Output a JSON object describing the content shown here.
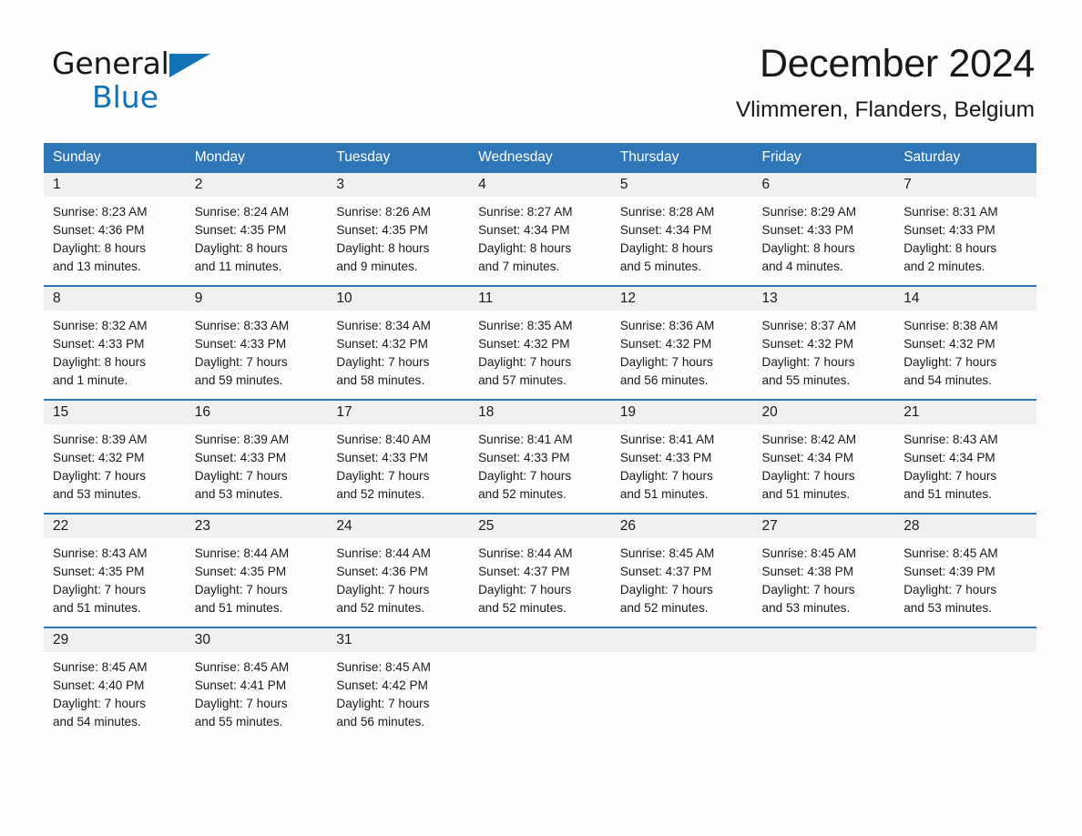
{
  "brand": {
    "word1": "General",
    "word2": "Blue",
    "triangle_color": "#1272b6",
    "text_color": "#17181a"
  },
  "header": {
    "title": "December 2024",
    "location": "Vlimmeren, Flanders, Belgium"
  },
  "theme": {
    "header_blue": "#2f76b8",
    "row_rule_blue": "#2f76b8",
    "daynum_band": "#f0f0f0",
    "page_background": "#fdfdfd",
    "text": "#1a1a1a"
  },
  "calendar": {
    "weekday_headers": [
      "Sunday",
      "Monday",
      "Tuesday",
      "Wednesday",
      "Thursday",
      "Friday",
      "Saturday"
    ],
    "labels": {
      "sunrise": "Sunrise:",
      "sunset": "Sunset:",
      "daylight": "Daylight:"
    },
    "weeks": [
      [
        {
          "day": "1",
          "sunrise": "Sunrise: 8:23 AM",
          "sunset": "Sunset: 4:36 PM",
          "daylight_line1": "Daylight: 8 hours",
          "daylight_line2": "and 13 minutes."
        },
        {
          "day": "2",
          "sunrise": "Sunrise: 8:24 AM",
          "sunset": "Sunset: 4:35 PM",
          "daylight_line1": "Daylight: 8 hours",
          "daylight_line2": "and 11 minutes."
        },
        {
          "day": "3",
          "sunrise": "Sunrise: 8:26 AM",
          "sunset": "Sunset: 4:35 PM",
          "daylight_line1": "Daylight: 8 hours",
          "daylight_line2": "and 9 minutes."
        },
        {
          "day": "4",
          "sunrise": "Sunrise: 8:27 AM",
          "sunset": "Sunset: 4:34 PM",
          "daylight_line1": "Daylight: 8 hours",
          "daylight_line2": "and 7 minutes."
        },
        {
          "day": "5",
          "sunrise": "Sunrise: 8:28 AM",
          "sunset": "Sunset: 4:34 PM",
          "daylight_line1": "Daylight: 8 hours",
          "daylight_line2": "and 5 minutes."
        },
        {
          "day": "6",
          "sunrise": "Sunrise: 8:29 AM",
          "sunset": "Sunset: 4:33 PM",
          "daylight_line1": "Daylight: 8 hours",
          "daylight_line2": "and 4 minutes."
        },
        {
          "day": "7",
          "sunrise": "Sunrise: 8:31 AM",
          "sunset": "Sunset: 4:33 PM",
          "daylight_line1": "Daylight: 8 hours",
          "daylight_line2": "and 2 minutes."
        }
      ],
      [
        {
          "day": "8",
          "sunrise": "Sunrise: 8:32 AM",
          "sunset": "Sunset: 4:33 PM",
          "daylight_line1": "Daylight: 8 hours",
          "daylight_line2": "and 1 minute."
        },
        {
          "day": "9",
          "sunrise": "Sunrise: 8:33 AM",
          "sunset": "Sunset: 4:33 PM",
          "daylight_line1": "Daylight: 7 hours",
          "daylight_line2": "and 59 minutes."
        },
        {
          "day": "10",
          "sunrise": "Sunrise: 8:34 AM",
          "sunset": "Sunset: 4:32 PM",
          "daylight_line1": "Daylight: 7 hours",
          "daylight_line2": "and 58 minutes."
        },
        {
          "day": "11",
          "sunrise": "Sunrise: 8:35 AM",
          "sunset": "Sunset: 4:32 PM",
          "daylight_line1": "Daylight: 7 hours",
          "daylight_line2": "and 57 minutes."
        },
        {
          "day": "12",
          "sunrise": "Sunrise: 8:36 AM",
          "sunset": "Sunset: 4:32 PM",
          "daylight_line1": "Daylight: 7 hours",
          "daylight_line2": "and 56 minutes."
        },
        {
          "day": "13",
          "sunrise": "Sunrise: 8:37 AM",
          "sunset": "Sunset: 4:32 PM",
          "daylight_line1": "Daylight: 7 hours",
          "daylight_line2": "and 55 minutes."
        },
        {
          "day": "14",
          "sunrise": "Sunrise: 8:38 AM",
          "sunset": "Sunset: 4:32 PM",
          "daylight_line1": "Daylight: 7 hours",
          "daylight_line2": "and 54 minutes."
        }
      ],
      [
        {
          "day": "15",
          "sunrise": "Sunrise: 8:39 AM",
          "sunset": "Sunset: 4:32 PM",
          "daylight_line1": "Daylight: 7 hours",
          "daylight_line2": "and 53 minutes."
        },
        {
          "day": "16",
          "sunrise": "Sunrise: 8:39 AM",
          "sunset": "Sunset: 4:33 PM",
          "daylight_line1": "Daylight: 7 hours",
          "daylight_line2": "and 53 minutes."
        },
        {
          "day": "17",
          "sunrise": "Sunrise: 8:40 AM",
          "sunset": "Sunset: 4:33 PM",
          "daylight_line1": "Daylight: 7 hours",
          "daylight_line2": "and 52 minutes."
        },
        {
          "day": "18",
          "sunrise": "Sunrise: 8:41 AM",
          "sunset": "Sunset: 4:33 PM",
          "daylight_line1": "Daylight: 7 hours",
          "daylight_line2": "and 52 minutes."
        },
        {
          "day": "19",
          "sunrise": "Sunrise: 8:41 AM",
          "sunset": "Sunset: 4:33 PM",
          "daylight_line1": "Daylight: 7 hours",
          "daylight_line2": "and 51 minutes."
        },
        {
          "day": "20",
          "sunrise": "Sunrise: 8:42 AM",
          "sunset": "Sunset: 4:34 PM",
          "daylight_line1": "Daylight: 7 hours",
          "daylight_line2": "and 51 minutes."
        },
        {
          "day": "21",
          "sunrise": "Sunrise: 8:43 AM",
          "sunset": "Sunset: 4:34 PM",
          "daylight_line1": "Daylight: 7 hours",
          "daylight_line2": "and 51 minutes."
        }
      ],
      [
        {
          "day": "22",
          "sunrise": "Sunrise: 8:43 AM",
          "sunset": "Sunset: 4:35 PM",
          "daylight_line1": "Daylight: 7 hours",
          "daylight_line2": "and 51 minutes."
        },
        {
          "day": "23",
          "sunrise": "Sunrise: 8:44 AM",
          "sunset": "Sunset: 4:35 PM",
          "daylight_line1": "Daylight: 7 hours",
          "daylight_line2": "and 51 minutes."
        },
        {
          "day": "24",
          "sunrise": "Sunrise: 8:44 AM",
          "sunset": "Sunset: 4:36 PM",
          "daylight_line1": "Daylight: 7 hours",
          "daylight_line2": "and 52 minutes."
        },
        {
          "day": "25",
          "sunrise": "Sunrise: 8:44 AM",
          "sunset": "Sunset: 4:37 PM",
          "daylight_line1": "Daylight: 7 hours",
          "daylight_line2": "and 52 minutes."
        },
        {
          "day": "26",
          "sunrise": "Sunrise: 8:45 AM",
          "sunset": "Sunset: 4:37 PM",
          "daylight_line1": "Daylight: 7 hours",
          "daylight_line2": "and 52 minutes."
        },
        {
          "day": "27",
          "sunrise": "Sunrise: 8:45 AM",
          "sunset": "Sunset: 4:38 PM",
          "daylight_line1": "Daylight: 7 hours",
          "daylight_line2": "and 53 minutes."
        },
        {
          "day": "28",
          "sunrise": "Sunrise: 8:45 AM",
          "sunset": "Sunset: 4:39 PM",
          "daylight_line1": "Daylight: 7 hours",
          "daylight_line2": "and 53 minutes."
        }
      ],
      [
        {
          "day": "29",
          "sunrise": "Sunrise: 8:45 AM",
          "sunset": "Sunset: 4:40 PM",
          "daylight_line1": "Daylight: 7 hours",
          "daylight_line2": "and 54 minutes."
        },
        {
          "day": "30",
          "sunrise": "Sunrise: 8:45 AM",
          "sunset": "Sunset: 4:41 PM",
          "daylight_line1": "Daylight: 7 hours",
          "daylight_line2": "and 55 minutes."
        },
        {
          "day": "31",
          "sunrise": "Sunrise: 8:45 AM",
          "sunset": "Sunset: 4:42 PM",
          "daylight_line1": "Daylight: 7 hours",
          "daylight_line2": "and 56 minutes."
        },
        {
          "day": "",
          "sunrise": "",
          "sunset": "",
          "daylight_line1": "",
          "daylight_line2": ""
        },
        {
          "day": "",
          "sunrise": "",
          "sunset": "",
          "daylight_line1": "",
          "daylight_line2": ""
        },
        {
          "day": "",
          "sunrise": "",
          "sunset": "",
          "daylight_line1": "",
          "daylight_line2": ""
        },
        {
          "day": "",
          "sunrise": "",
          "sunset": "",
          "daylight_line1": "",
          "daylight_line2": ""
        }
      ]
    ]
  }
}
